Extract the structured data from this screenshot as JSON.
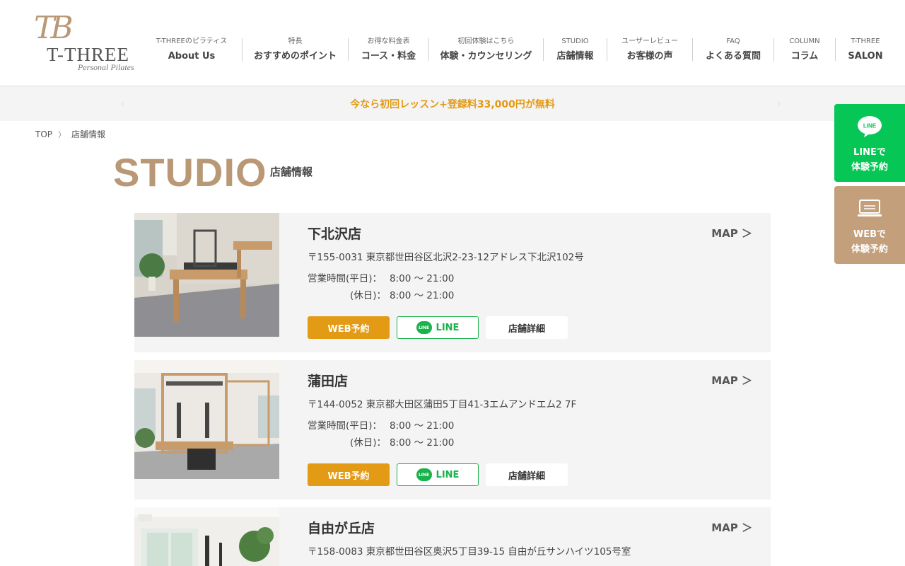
{
  "logo": {
    "mono": "TB",
    "name": "T-THREE",
    "tagline": "Personal Pilates"
  },
  "nav": [
    {
      "sub": "T-THREEのピラティス",
      "main": "About Us"
    },
    {
      "sub": "特長",
      "main": "おすすめのポイント"
    },
    {
      "sub": "お得な料金表",
      "main": "コース・料金"
    },
    {
      "sub": "初回体験はこちら",
      "main": "体験・カウンセリング"
    },
    {
      "sub": "STUDIO",
      "main": "店舗情報"
    },
    {
      "sub": "ユーザーレビュー",
      "main": "お客様の声"
    },
    {
      "sub": "FAQ",
      "main": "よくある質問"
    },
    {
      "sub": "COLUMN",
      "main": "コラム"
    },
    {
      "sub": "T-THREE",
      "main": "SALON"
    }
  ],
  "banner": {
    "text": "今なら初回レッスン+登録料33,000円が無料",
    "prev": "‹",
    "next": "›"
  },
  "breadcrumb": {
    "home": "TOP",
    "sep": "〉",
    "current": "店舗情報"
  },
  "title": {
    "main": "STUDIO",
    "sub": "店舗情報"
  },
  "stores": [
    {
      "name": "下北沢店",
      "address": "〒155-0031 東京都世田谷区北沢2-23-12アドレス下北沢102号",
      "weekday_label": "営業時間(平日)：",
      "weekday_hours": "8:00 〜 21:00",
      "holiday_label": "(休日)：",
      "holiday_hours": "8:00 〜 21:00",
      "map": "MAP ＞"
    },
    {
      "name": "蒲田店",
      "address": "〒144-0052 東京都大田区蒲田5丁目41-3エムアンドエム2 7F",
      "weekday_label": "営業時間(平日)：",
      "weekday_hours": "8:00 〜 21:00",
      "holiday_label": "(休日)：",
      "holiday_hours": "8:00 〜 21:00",
      "map": "MAP ＞"
    },
    {
      "name": "自由が丘店",
      "address": "〒158-0083 東京都世田谷区奥沢5丁目39-15 自由が丘サンハイツ105号室",
      "map": "MAP ＞"
    }
  ],
  "buttons": {
    "web": "WEB予約",
    "line": "LINE",
    "detail": "店舗詳細",
    "line_badge": "LINE"
  },
  "side": {
    "line_icon_text": "LINE",
    "line_1": "LINEで",
    "line_2": "体験予約",
    "web_1": "WEBで",
    "web_2": "体験予約"
  },
  "colors": {
    "accent": "#b99876",
    "orange": "#e39a14",
    "line_green": "#06c755",
    "card_bg": "#f4f4f4"
  }
}
